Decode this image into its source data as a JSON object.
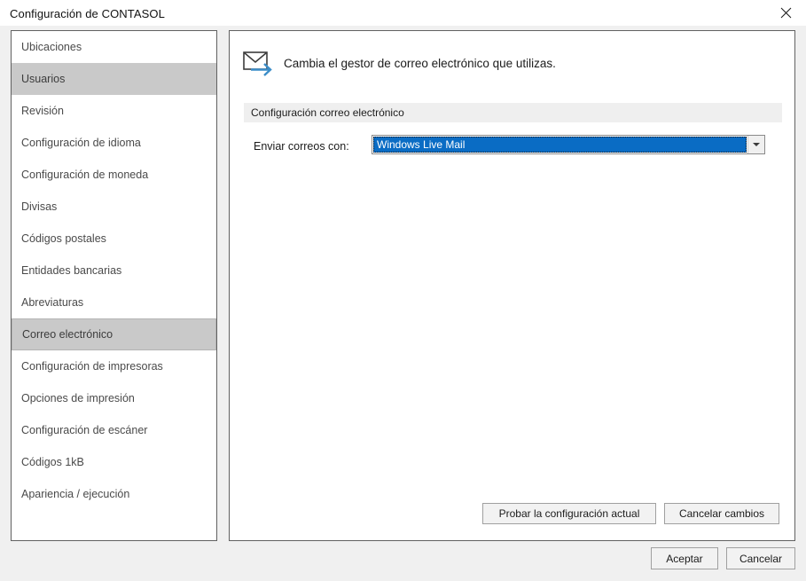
{
  "window": {
    "title": "Configuración de CONTASOL",
    "close_icon": "close-icon"
  },
  "sidebar": {
    "items": [
      {
        "label": "Ubicaciones",
        "state": "normal"
      },
      {
        "label": "Usuarios",
        "state": "hovered"
      },
      {
        "label": "Revisión",
        "state": "normal"
      },
      {
        "label": "Configuración de idioma",
        "state": "normal"
      },
      {
        "label": "Configuración de moneda",
        "state": "normal"
      },
      {
        "label": "Divisas",
        "state": "normal"
      },
      {
        "label": "Códigos postales",
        "state": "normal"
      },
      {
        "label": "Entidades bancarias",
        "state": "normal"
      },
      {
        "label": "Abreviaturas",
        "state": "normal"
      },
      {
        "label": "Correo electrónico",
        "state": "selected"
      },
      {
        "label": "Configuración de impresoras",
        "state": "normal"
      },
      {
        "label": "Opciones de impresión",
        "state": "normal"
      },
      {
        "label": "Configuración de escáner",
        "state": "normal"
      },
      {
        "label": "Códigos 1kB",
        "state": "normal"
      },
      {
        "label": "Apariencia / ejecución",
        "state": "normal"
      }
    ]
  },
  "panel": {
    "header_icon": "mail-send-icon",
    "header_text": "Cambia el gestor de correo electrónico que utilizas.",
    "section_title": "Configuración correo electrónico",
    "field": {
      "label": "Enviar correos con:",
      "value": "Windows Live Mail",
      "arrow_icon": "chevron-down-icon"
    },
    "actions": {
      "test": "Probar la configuración actual",
      "cancel_changes": "Cancelar cambios"
    }
  },
  "footer": {
    "accept": "Aceptar",
    "cancel": "Cancelar"
  },
  "colors": {
    "selection_blue": "#0a6cc4",
    "sidebar_highlight": "#c9c9c9",
    "dialog_background": "#f0f0f0",
    "section_band": "#efefef",
    "icon_accent_blue": "#3c8dc8"
  }
}
